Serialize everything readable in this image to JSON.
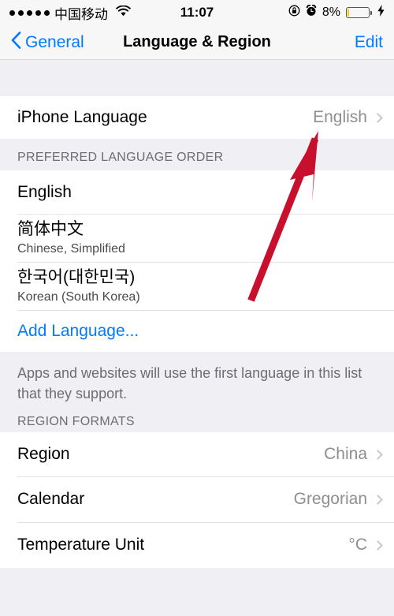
{
  "status_bar": {
    "signal_dots": 5,
    "carrier": "中国移动",
    "wifi_icon": "wifi-icon",
    "time": "11:07",
    "rotation_lock_icon": "rotation-lock-icon",
    "alarm_icon": "alarm-clock-icon",
    "battery_percent": "8%",
    "battery_level": 8,
    "battery_color": "#FFCC00",
    "charging_icon": "lightning-bolt-icon"
  },
  "nav": {
    "back_label": "General",
    "title": "Language & Region",
    "edit_label": "Edit"
  },
  "language_section": {
    "rows": [
      {
        "label": "iPhone Language",
        "value": "English"
      }
    ]
  },
  "preferred_section": {
    "header": "PREFERRED LANGUAGE ORDER",
    "rows": [
      {
        "label": "English",
        "sublabel": ""
      },
      {
        "label": "简体中文",
        "sublabel": "Chinese, Simplified"
      },
      {
        "label": "한국어(대한민국)",
        "sublabel": "Korean (South Korea)"
      }
    ],
    "add_label": "Add Language...",
    "footer": "Apps and websites will use the first language in this list that they support."
  },
  "region_section": {
    "header": "REGION FORMATS",
    "rows": [
      {
        "label": "Region",
        "value": "China"
      },
      {
        "label": "Calendar",
        "value": "Gregorian"
      },
      {
        "label": "Temperature Unit",
        "value": "°C"
      }
    ]
  },
  "annotation": {
    "arrow_color": "#C8102E",
    "arrow_target": "iPhone Language value English"
  },
  "colors": {
    "accent": "#007AFF",
    "background": "#EFEFF4",
    "row_background": "#FFFFFF",
    "secondary_text": "#8E8E93"
  }
}
